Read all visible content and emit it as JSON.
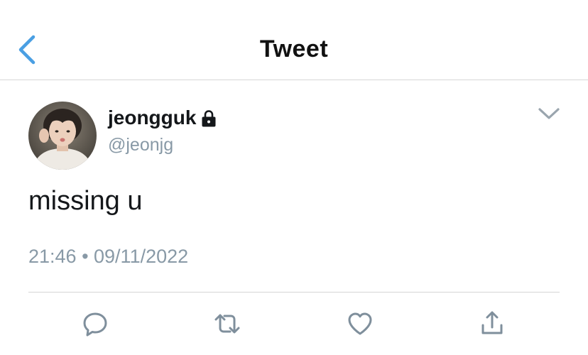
{
  "navbar": {
    "title": "Tweet",
    "back_icon": "chevron-left-icon",
    "accent_color": "#4a9fe3"
  },
  "tweet": {
    "display_name": "jeongguk",
    "handle": "@jeonjg",
    "protected_icon": "lock-icon",
    "menu_icon": "chevron-down-icon",
    "text": "missing u",
    "timestamp": "21:46 • 09/11/2022"
  },
  "actions": [
    {
      "icon": "reply-icon"
    },
    {
      "icon": "retweet-icon"
    },
    {
      "icon": "like-icon"
    },
    {
      "icon": "share-icon"
    }
  ],
  "colors": {
    "text_primary": "#14171a",
    "text_secondary": "#8899a6",
    "icon_gray": "#7f8f9c",
    "divider": "#d6d6d6"
  }
}
